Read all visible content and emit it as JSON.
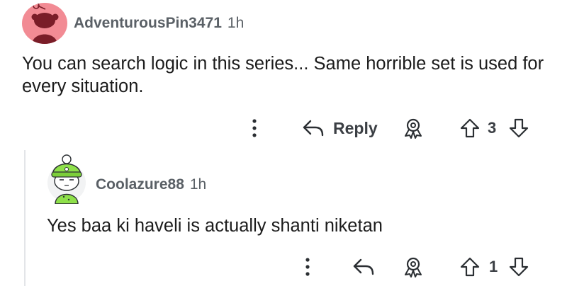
{
  "comment": {
    "username": "AdventurousPin3471",
    "time": "1h",
    "body": "You can search logic in this series... Same horrible set is used for every situation.",
    "actions": {
      "more_icon": "vertical-dots-icon",
      "reply_icon": "reply-arrow-icon",
      "reply_label": "Reply",
      "award_icon": "award-icon",
      "upvote_icon": "arrow-up-icon",
      "vote_count": "3",
      "downvote_icon": "arrow-down-icon"
    },
    "avatar_color": "#f28b94"
  },
  "reply": {
    "username": "Coolazure88",
    "time": "1h",
    "body": "Yes baa ki haveli is actually shanti niketan",
    "actions": {
      "more_icon": "vertical-dots-icon",
      "reply_icon": "reply-arrow-icon",
      "award_icon": "award-icon",
      "upvote_icon": "arrow-up-icon",
      "vote_count": "1",
      "downvote_icon": "arrow-down-icon"
    },
    "avatar_color": "#8ee04a"
  }
}
